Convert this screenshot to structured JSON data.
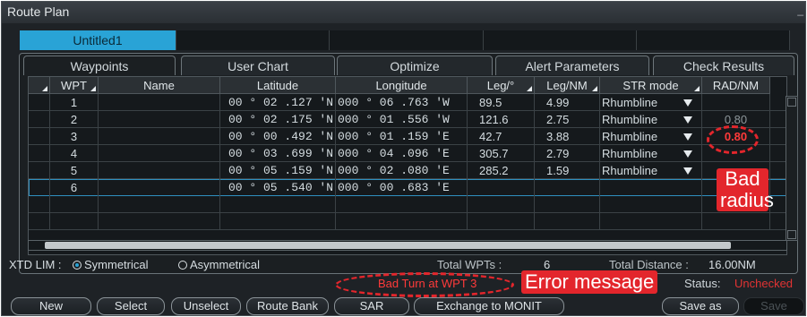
{
  "window": {
    "title": "Route Plan",
    "minimize_glyph": "_"
  },
  "route_tabs": [
    {
      "label": "Untitled1"
    }
  ],
  "page_tabs": [
    "Waypoints",
    "User Chart",
    "Optimize",
    "Alert Parameters",
    "Check Results"
  ],
  "table": {
    "columns": [
      "WPT",
      "Name",
      "Latitude",
      "Longitude",
      "Leg/°",
      "Leg/NM",
      "STR mode",
      "RAD/NM"
    ],
    "rows": [
      {
        "wpt": "1",
        "name": "",
        "lat": "00 ° 02 .127 'N",
        "lon": "000 ° 06 .763 'W",
        "leg_deg": "89.5",
        "leg_nm": "4.99",
        "str": "Rhumbline",
        "rad": ""
      },
      {
        "wpt": "2",
        "name": "",
        "lat": "00 ° 02 .175 'N",
        "lon": "000 ° 01 .556 'W",
        "leg_deg": "121.6",
        "leg_nm": "2.75",
        "str": "Rhumbline",
        "rad": "0.80"
      },
      {
        "wpt": "3",
        "name": "",
        "lat": "00 ° 00 .492 'N",
        "lon": "000 ° 01 .159 'E",
        "leg_deg": "42.7",
        "leg_nm": "3.88",
        "str": "Rhumbline",
        "rad": "0.80"
      },
      {
        "wpt": "4",
        "name": "",
        "lat": "00 ° 03 .699 'N",
        "lon": "000 ° 04 .096 'E",
        "leg_deg": "305.7",
        "leg_nm": "2.79",
        "str": "Rhumbline",
        "rad": ""
      },
      {
        "wpt": "5",
        "name": "",
        "lat": "00 ° 05 .159 'N",
        "lon": "000 ° 02 .080 'E",
        "leg_deg": "285.2",
        "leg_nm": "1.59",
        "str": "Rhumbline",
        "rad": ""
      },
      {
        "wpt": "6",
        "name": "",
        "lat": "00 ° 05 .540 'N",
        "lon": "000 ° 00 .683 'E",
        "leg_deg": "",
        "leg_nm": "",
        "str": "",
        "rad": ""
      }
    ]
  },
  "xtd": {
    "label": "XTD LIM :",
    "options": [
      "Symmetrical",
      "Asymmetrical"
    ],
    "selected": "Symmetrical"
  },
  "totals": {
    "wpts_label": "Total WPTs :",
    "wpts_value": "6",
    "distance_label": "Total Distance :",
    "distance_value": "16.00NM"
  },
  "status": {
    "message": "Bad Turn at WPT 3",
    "label": "Status:",
    "value": "Unchecked",
    "value_color": "#e13333"
  },
  "buttons": [
    "New",
    "Select",
    "Unselect",
    "Route Bank",
    "SAR",
    "Exchange to MONIT",
    "Save as",
    "Save"
  ],
  "annotations": {
    "bad_radius": "Bad radius",
    "bad_radius_line1": "Bad",
    "bad_radius_line2": "radius",
    "error_message": "Error message"
  },
  "colors": {
    "accent": "#29a3d6",
    "annotation": "#e3262c",
    "error_text": "#ff3a3a"
  }
}
